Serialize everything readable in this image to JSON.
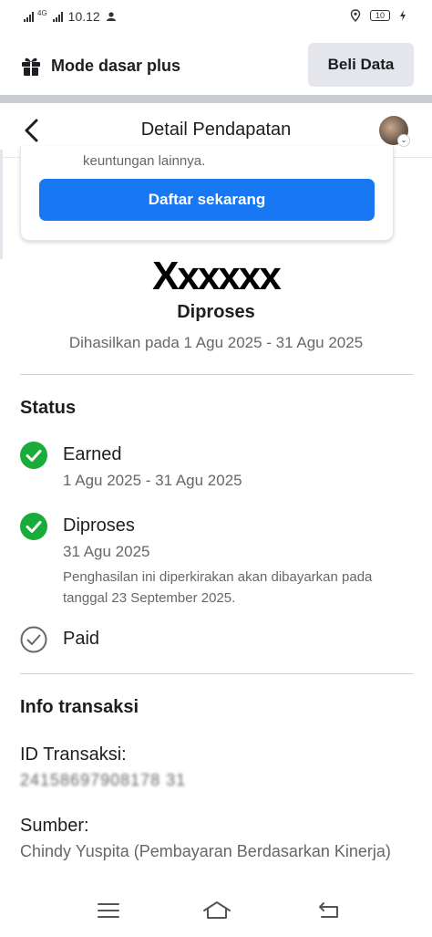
{
  "status_bar": {
    "network": "4G",
    "time": "10.12",
    "battery": "10"
  },
  "mode_bar": {
    "title": "Mode dasar plus",
    "buy_button": "Beli Data"
  },
  "header": {
    "title": "Detail Pendapatan"
  },
  "promo_card": {
    "text": "keuntungan lainnya.",
    "button": "Daftar sekarang"
  },
  "summary": {
    "amount": "Xxxxxx",
    "state": "Diproses",
    "period": "Dihasilkan pada 1 Agu 2025 - 31 Agu 2025"
  },
  "status": {
    "title": "Status",
    "steps": [
      {
        "title": "Earned",
        "sub": "1 Agu 2025 - 31 Agu 2025",
        "done": true
      },
      {
        "title": "Diproses",
        "sub": "31 Agu 2025",
        "note": "Penghasilan ini diperkirakan akan dibayarkan pada tanggal 23 September 2025.",
        "done": true
      },
      {
        "title": "Paid",
        "done": false
      }
    ]
  },
  "transaction": {
    "title": "Info transaksi",
    "id_label": "ID Transaksi:",
    "id_value": "24158697908178 31",
    "source_label": "Sumber:",
    "source_value": "Chindy Yuspita (Pembayaran Berdasarkan Kinerja)"
  },
  "colors": {
    "accent": "#1877f2",
    "success": "#1aac3b",
    "text": "#1c1e21",
    "muted": "#65676b"
  }
}
